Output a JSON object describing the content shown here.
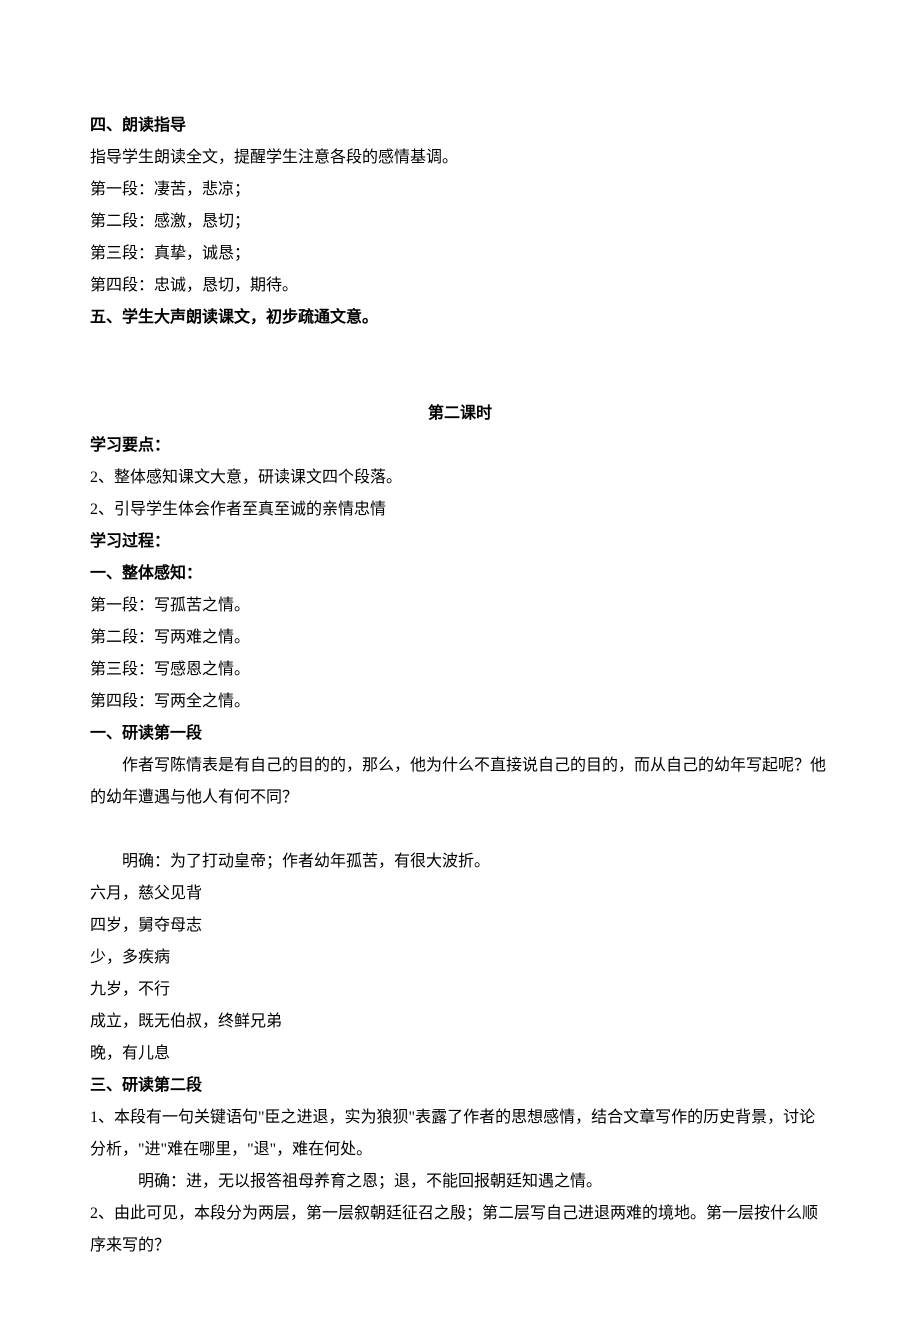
{
  "section4": {
    "title": "四、朗读指导",
    "intro": "指导学生朗读全文，提醒学生注意各段的感情基调。",
    "p1": "第一段：凄苦，悲凉；",
    "p2": "第二段：感激，恳切；",
    "p3": "第三段：真挚，诚恳；",
    "p4": "第四段：忠诚，恳切，期待。"
  },
  "section5": {
    "title": "五、学生大声朗读课文，初步疏通文意。"
  },
  "lesson2": {
    "title": "第二课时",
    "points_label": "学习要点：",
    "point1": "2、整体感知课文大意，研读课文四个段落。",
    "point2": "2、引导学生体会作者至真至诚的亲情忠情",
    "process_label": "学习过程：",
    "overall_title": "一、整体感知：",
    "overall_p1": "第一段：写孤苦之情。",
    "overall_p2": "第二段：写两难之情。",
    "overall_p3": "第三段：写感恩之情。",
    "overall_p4": "第四段：写两全之情。",
    "read1_title": "一、研读第一段",
    "read1_q": "作者写陈情表是有自己的目的的，那么，他为什么不直接说自己的目的，而从自己的幼年写起呢？他的幼年遭遇与他人有何不同？",
    "read1_answer": "明确：为了打动皇帝；作者幼年孤苦，有很大波折。",
    "read1_l1": "六月，慈父见背",
    "read1_l2": "四岁，舅夺母志",
    "read1_l3": "少，多疾病",
    "read1_l4": "九岁，不行",
    "read1_l5": "成立，既无伯叔，终鲜兄弟",
    "read1_l6": "晚，有儿息",
    "read2_title": "三、研读第二段",
    "read2_q1": "1、本段有一句关键语句\"臣之进退，实为狼狈\"表露了作者的思想感情，结合文章写作的历史背景，讨论分析，\"进\"难在哪里，\"退\"，难在何处。",
    "read2_a1": "明确：进，无以报答祖母养育之恩；退，不能回报朝廷知遇之情。",
    "read2_q2": "2、由此可见，本段分为两层，第一层叙朝廷征召之殷；第二层写自己进退两难的境地。第一层按什么顺序来写的？"
  }
}
